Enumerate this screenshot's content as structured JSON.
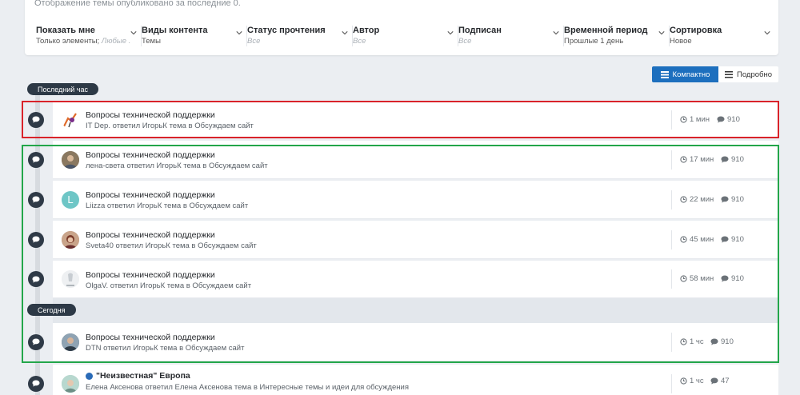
{
  "filter_notice": "Отображение темы опубликовано за последние 0.",
  "filters": [
    {
      "label": "Показать мне",
      "value": "Только элементы;",
      "value_muted": " Любые ..."
    },
    {
      "label": "Виды контента",
      "value": "Темы"
    },
    {
      "label": "Статус прочтения",
      "placeholder": "Все"
    },
    {
      "label": "Автор",
      "placeholder": "Все"
    },
    {
      "label": "Подписан",
      "placeholder": "Все"
    },
    {
      "label": "Временной период",
      "value": "Прошлые 1 день"
    },
    {
      "label": "Сортировка",
      "value": "Новое"
    }
  ],
  "view_toggle": {
    "compact": "Компактно",
    "detailed": "Подробно"
  },
  "periods": {
    "last_hour": "Последний час",
    "today": "Сегодня"
  },
  "items": [
    {
      "title": "Вопросы технической поддержки",
      "meta": "IT Dep. ответил ИгорьК тема в Обсуждаем сайт",
      "time": "1 мин",
      "replies": "910"
    },
    {
      "title": "Вопросы технической поддержки",
      "meta": "лена-света ответил ИгорьК тема в Обсуждаем сайт",
      "time": "17 мин",
      "replies": "910"
    },
    {
      "title": "Вопросы технической поддержки",
      "meta": "Liizza ответил ИгорьК тема в Обсуждаем сайт",
      "time": "22 мин",
      "replies": "910",
      "avatar_letter": "L"
    },
    {
      "title": "Вопросы технической поддержки",
      "meta": "Sveta40 ответил ИгорьК тема в Обсуждаем сайт",
      "time": "45 мин",
      "replies": "910"
    },
    {
      "title": "Вопросы технической поддержки",
      "meta": "OlgaV. ответил ИгорьК тема в Обсуждаем сайт",
      "time": "58 мин",
      "replies": "910"
    },
    {
      "title": "Вопросы технической поддержки",
      "meta": "DTN ответил ИгорьК тема в Обсуждаем сайт",
      "time": "1 чс",
      "replies": "910"
    },
    {
      "title": "\"Неизвестная\" Европа",
      "meta": "Елена Аксенова ответил Елена Аксенова тема в Интересные темы и идеи для обсуждения",
      "time": "1 чс",
      "replies": "47"
    }
  ],
  "colors": {
    "accent": "#1d6fbe",
    "timeline_badge": "#2d3946",
    "highlight_red": "#d9232a",
    "highlight_green": "#23a64a",
    "unread_dot": "#2a6bb7"
  }
}
